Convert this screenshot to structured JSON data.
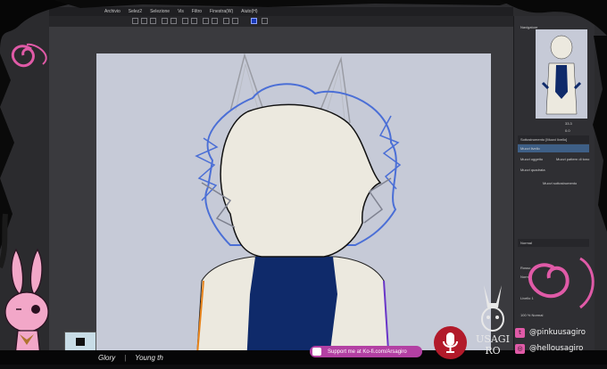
{
  "menu": {
    "items": [
      "Archivio",
      "Selez2",
      "Selezione",
      "Vis",
      "Filtro",
      "Finestra(W)",
      "Aiuto(H)"
    ]
  },
  "right_panel": {
    "navigator_label": "Navigatore",
    "zoom_value": "33.3",
    "angle_value": "0.0",
    "panel_label": "Sottostrumento [Muovi livello]",
    "rows": [
      "Muovi livello",
      "Muovi oggetto",
      "Muovi pattern di tono",
      "Muovi quadrata",
      "Muovi sottostrumento"
    ],
    "layer_blend": "Normal",
    "layers": [
      "Rosso",
      "Normal",
      "Livello 1",
      "100 % Normal"
    ]
  },
  "stream": {
    "song_title": "Glory",
    "song_artist": "Young th",
    "kofi_text": "Support me at Ko-fi.com/Arsagiro",
    "social_twitter": "@pinkuusagiro",
    "social_insta": "@hellousagiro",
    "logo_text": "USAGI RO"
  },
  "colors": {
    "canvas": "#c6cad7",
    "accent_pink": "#e05aa7",
    "kofi": "#b340a3",
    "mic": "#b21a2a",
    "hair_blue": "#4b6fd6",
    "body_navy": "#0f2a6a"
  }
}
